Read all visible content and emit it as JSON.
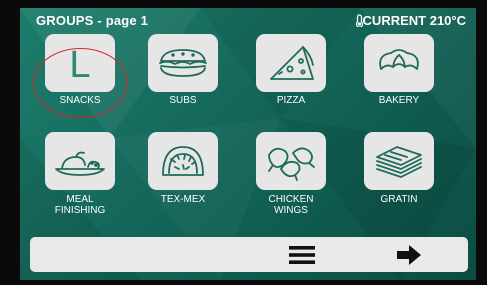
{
  "header": {
    "title": "GROUPS - page 1",
    "current_temp": "CURRENT 210°C"
  },
  "groups": [
    {
      "label": "SNACKS",
      "icon": "snacks-letter-icon",
      "glyph": "L",
      "selected": true
    },
    {
      "label": "SUBS",
      "icon": "sub-sandwich-icon"
    },
    {
      "label": "PIZZA",
      "icon": "pizza-slice-icon"
    },
    {
      "label": "BAKERY",
      "icon": "croissant-icon"
    },
    {
      "label": "MEAL\nFINISHING",
      "icon": "meal-plate-icon"
    },
    {
      "label": "TEX-MEX",
      "icon": "taco-icon"
    },
    {
      "label": "CHICKEN\nWINGS",
      "icon": "chicken-wings-icon"
    },
    {
      "label": "GRATIN",
      "icon": "gratin-dish-icon"
    }
  ],
  "bottom_bar": {
    "menu_icon": "hamburger-menu-icon",
    "next_icon": "arrow-right-icon"
  },
  "colors": {
    "background": "#15695c",
    "tile": "#e6e6e6",
    "icon_stroke": "#1f6b5a",
    "highlight": "#d7262c"
  }
}
